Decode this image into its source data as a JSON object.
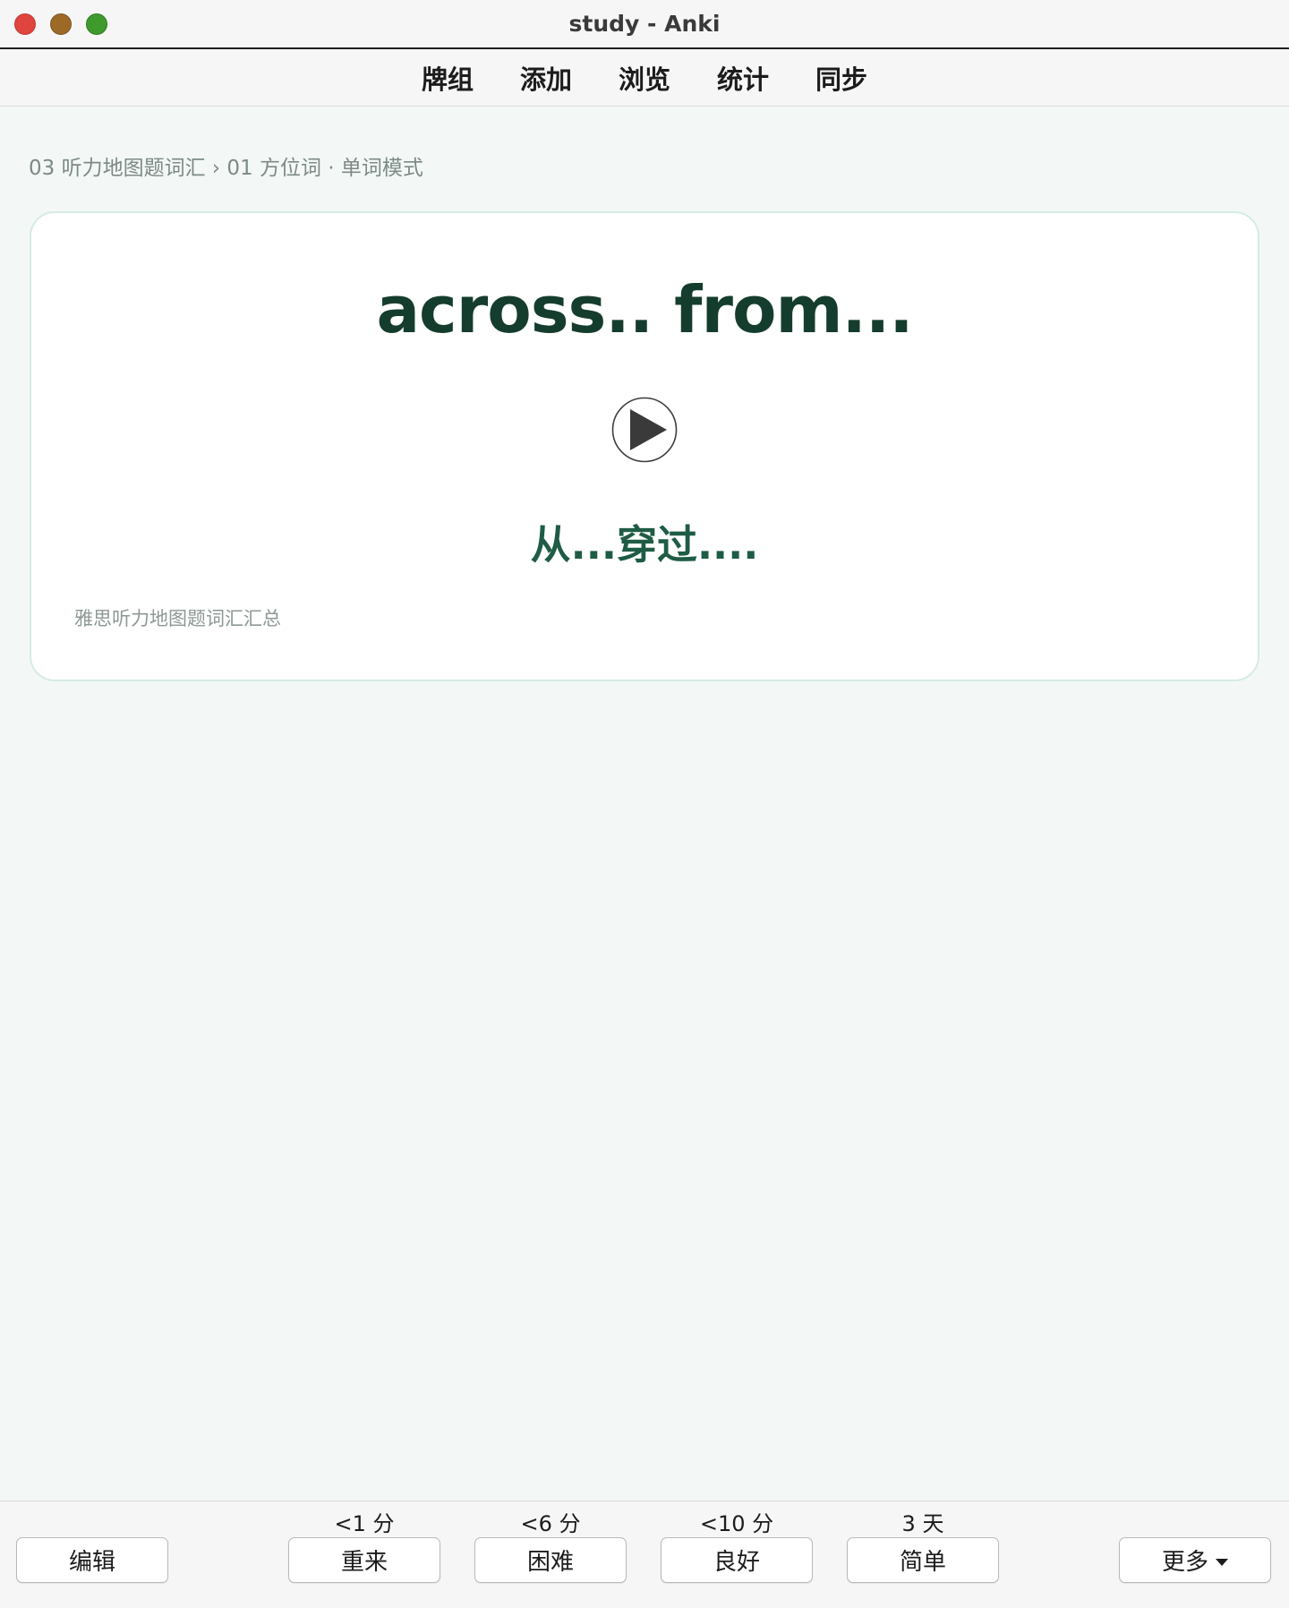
{
  "window": {
    "title": "study - Anki"
  },
  "toolbar": {
    "items": [
      "牌组",
      "添加",
      "浏览",
      "统计",
      "同步"
    ]
  },
  "breadcrumb": "03 听力地图题词汇 › 01 方位词 · 单词模式",
  "card": {
    "front": "across.. from...",
    "back": "从...穿过....",
    "source": "雅思听力地图题词汇汇总",
    "play_icon": "play-icon"
  },
  "bottom": {
    "edit_label": "编辑",
    "more_label": "更多",
    "answers": [
      {
        "interval": "<1 分",
        "label": "重来"
      },
      {
        "interval": "<6 分",
        "label": "困难"
      },
      {
        "interval": "<10 分",
        "label": "良好"
      },
      {
        "interval": "3 天",
        "label": "简单"
      }
    ]
  },
  "colors": {
    "front_text": "#153d2e",
    "back_text": "#1f5c45",
    "background": "#f3f8f6",
    "card_border": "#d5ebe4"
  }
}
